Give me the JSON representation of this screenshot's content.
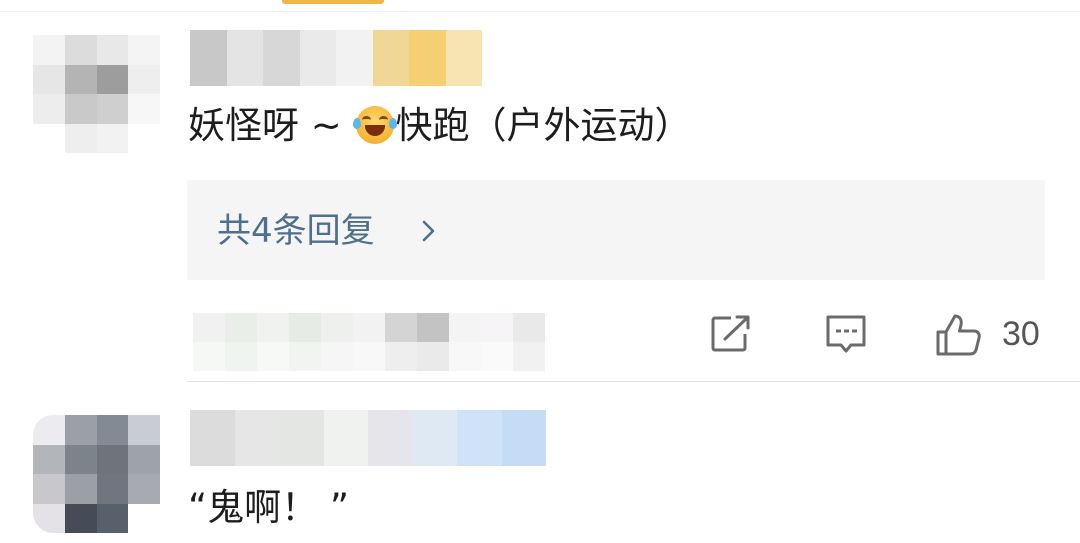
{
  "comments": [
    {
      "text_before_emoji": "妖怪呀 ~ ",
      "emoji": "laughing-crying-face-icon",
      "text_after_emoji": "快跑（户外运动）",
      "replies_label": "共4条回复",
      "like_count": "30"
    },
    {
      "text": "“鬼啊！ ”"
    }
  ],
  "colors": {
    "reply_link": "#4f6f8f",
    "reply_box_bg": "#f5f5f5",
    "action_icon": "#6b6b6b",
    "top_accent": "#f0b646"
  }
}
